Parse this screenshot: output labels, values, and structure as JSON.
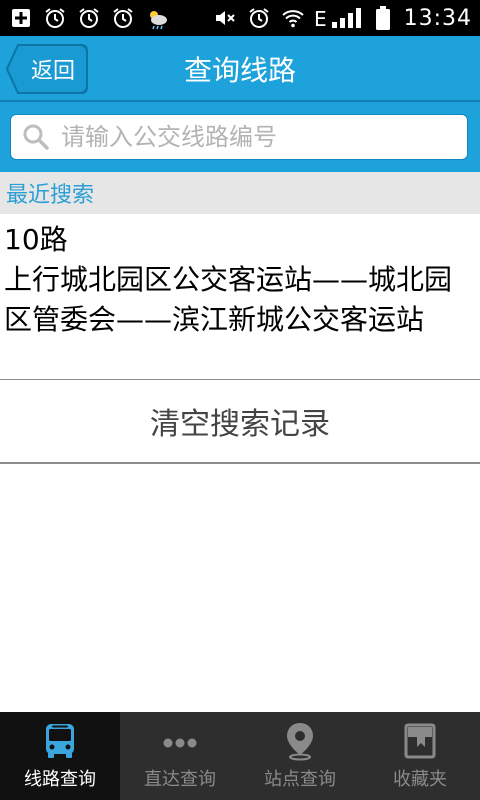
{
  "statusbar": {
    "time": "13:34",
    "network_label": "E",
    "icons_left": [
      "plus-icon",
      "alarm-icon",
      "alarm-icon",
      "alarm-icon",
      "weather-icon"
    ],
    "icons_right": [
      "mute-icon",
      "alarm-icon",
      "wifi-icon",
      "signal-icon",
      "battery-icon"
    ]
  },
  "header": {
    "back_label": "返回",
    "title": "查询线路"
  },
  "search": {
    "placeholder": "请输入公交线路编号"
  },
  "recent": {
    "title": "最近搜索",
    "items": [
      {
        "route": "10路",
        "description": "上行城北园区公交客运站——城北园区管委会——滨江新城公交客运站"
      }
    ]
  },
  "clear_label": "清空搜索记录",
  "bottom_nav": [
    {
      "label": "线路查询",
      "icon": "bus-icon",
      "active": true
    },
    {
      "label": "直达查询",
      "icon": "dots-icon",
      "active": false
    },
    {
      "label": "站点查询",
      "icon": "location-pin-icon",
      "active": false
    },
    {
      "label": "收藏夹",
      "icon": "bookmark-icon",
      "active": false
    }
  ],
  "colors": {
    "accent": "#1da2dc",
    "accent_dark": "#0f7fb4",
    "recent_text": "#2a9fd6",
    "nav_bg": "#2e2e2e",
    "nav_active_bg": "#111111",
    "bus_icon": "#3aa6dd"
  }
}
